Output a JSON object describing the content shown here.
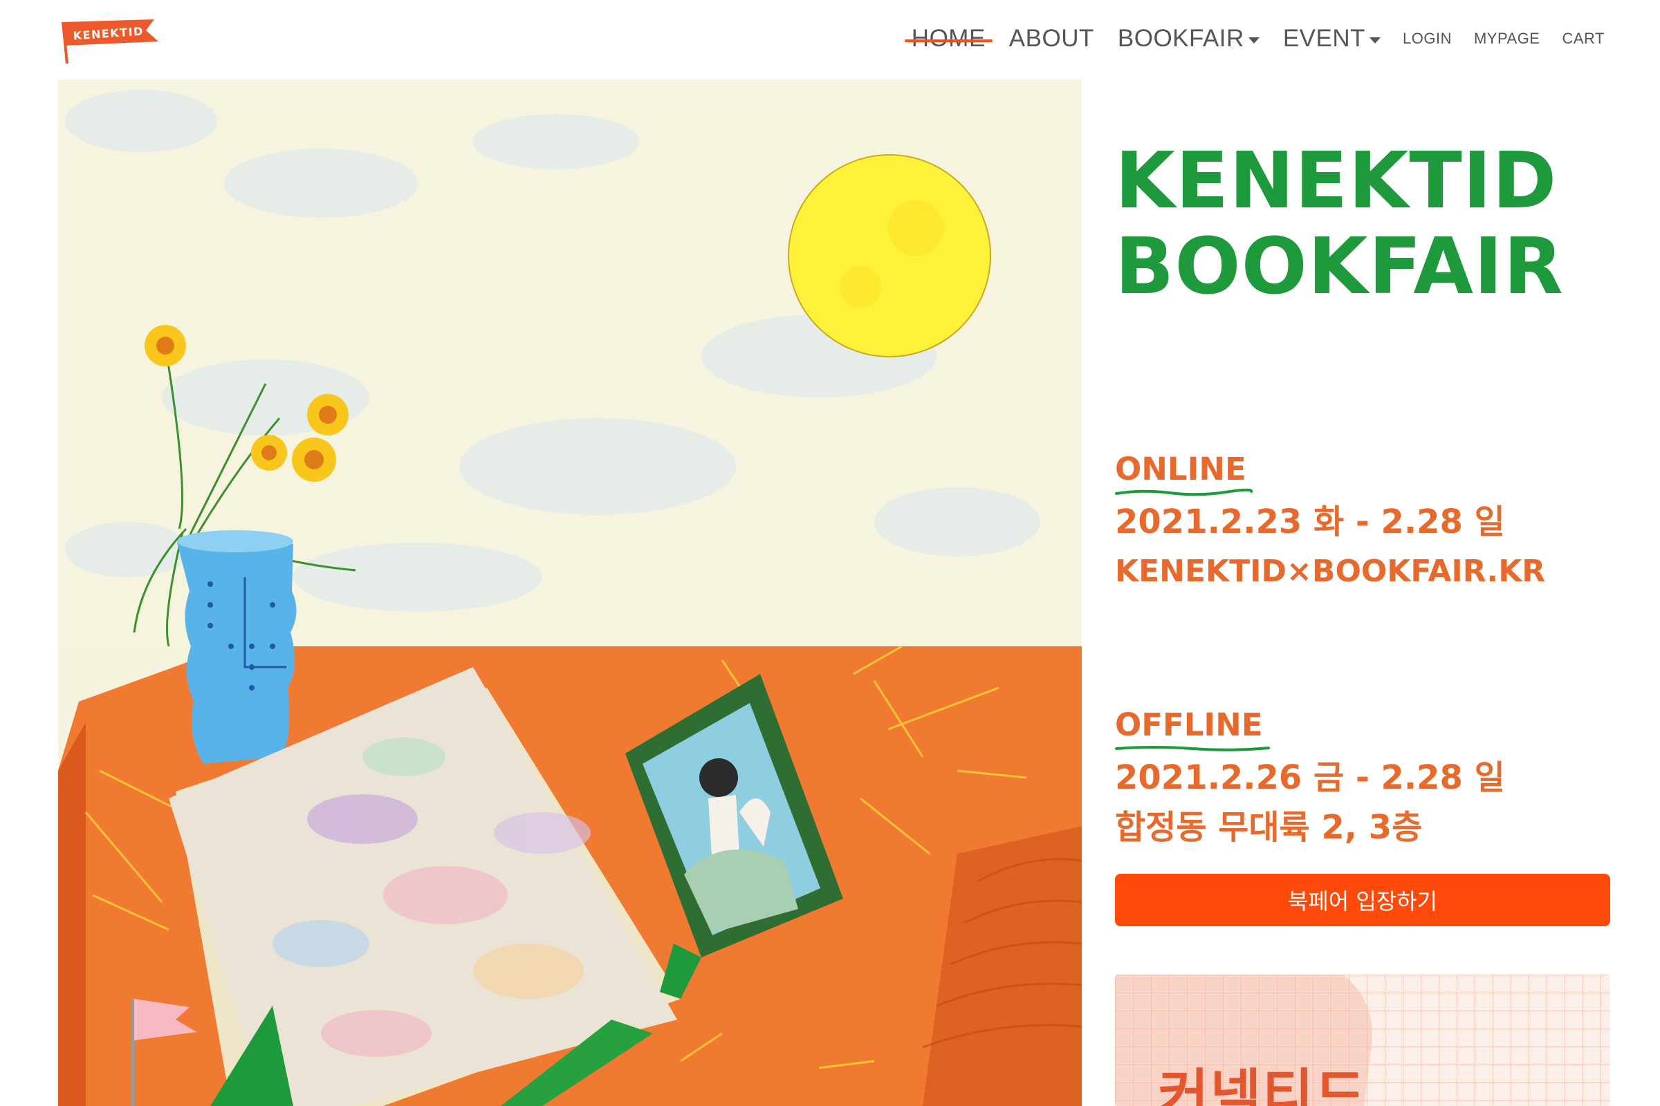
{
  "brand": {
    "logo_text": "KENEKTID",
    "accent_color": "#ff4f14",
    "green_color": "#1e9a3c",
    "orange_text_color": "#e8692c"
  },
  "nav": {
    "main": [
      {
        "label": "HOME",
        "active": true,
        "has_dropdown": false
      },
      {
        "label": "ABOUT",
        "active": false,
        "has_dropdown": false
      },
      {
        "label": "BOOKFAIR",
        "active": false,
        "has_dropdown": true
      },
      {
        "label": "EVENT",
        "active": false,
        "has_dropdown": true
      }
    ],
    "util": [
      {
        "label": "LOGIN"
      },
      {
        "label": "MYPAGE"
      },
      {
        "label": "CART"
      }
    ]
  },
  "hero": {
    "title_line1": "KENEKTID",
    "title_line2": "BOOKFAIR"
  },
  "online": {
    "label": "ONLINE",
    "dates": "2021.2.23 화 - 2.28 일",
    "site": "KENEKTID×BOOKFAIR.KR"
  },
  "offline": {
    "label": "OFFLINE",
    "dates": "2021.2.26 금 - 2.28 일",
    "venue": "합정동 무대륙 2, 3층"
  },
  "cta": {
    "enter_label": "북페어 입장하기"
  },
  "card": {
    "text": "커넥티드"
  },
  "illustration_icons": [
    "sun-icon",
    "flower-vase-icon",
    "book-icon",
    "picture-frame-icon",
    "flag-icon"
  ]
}
